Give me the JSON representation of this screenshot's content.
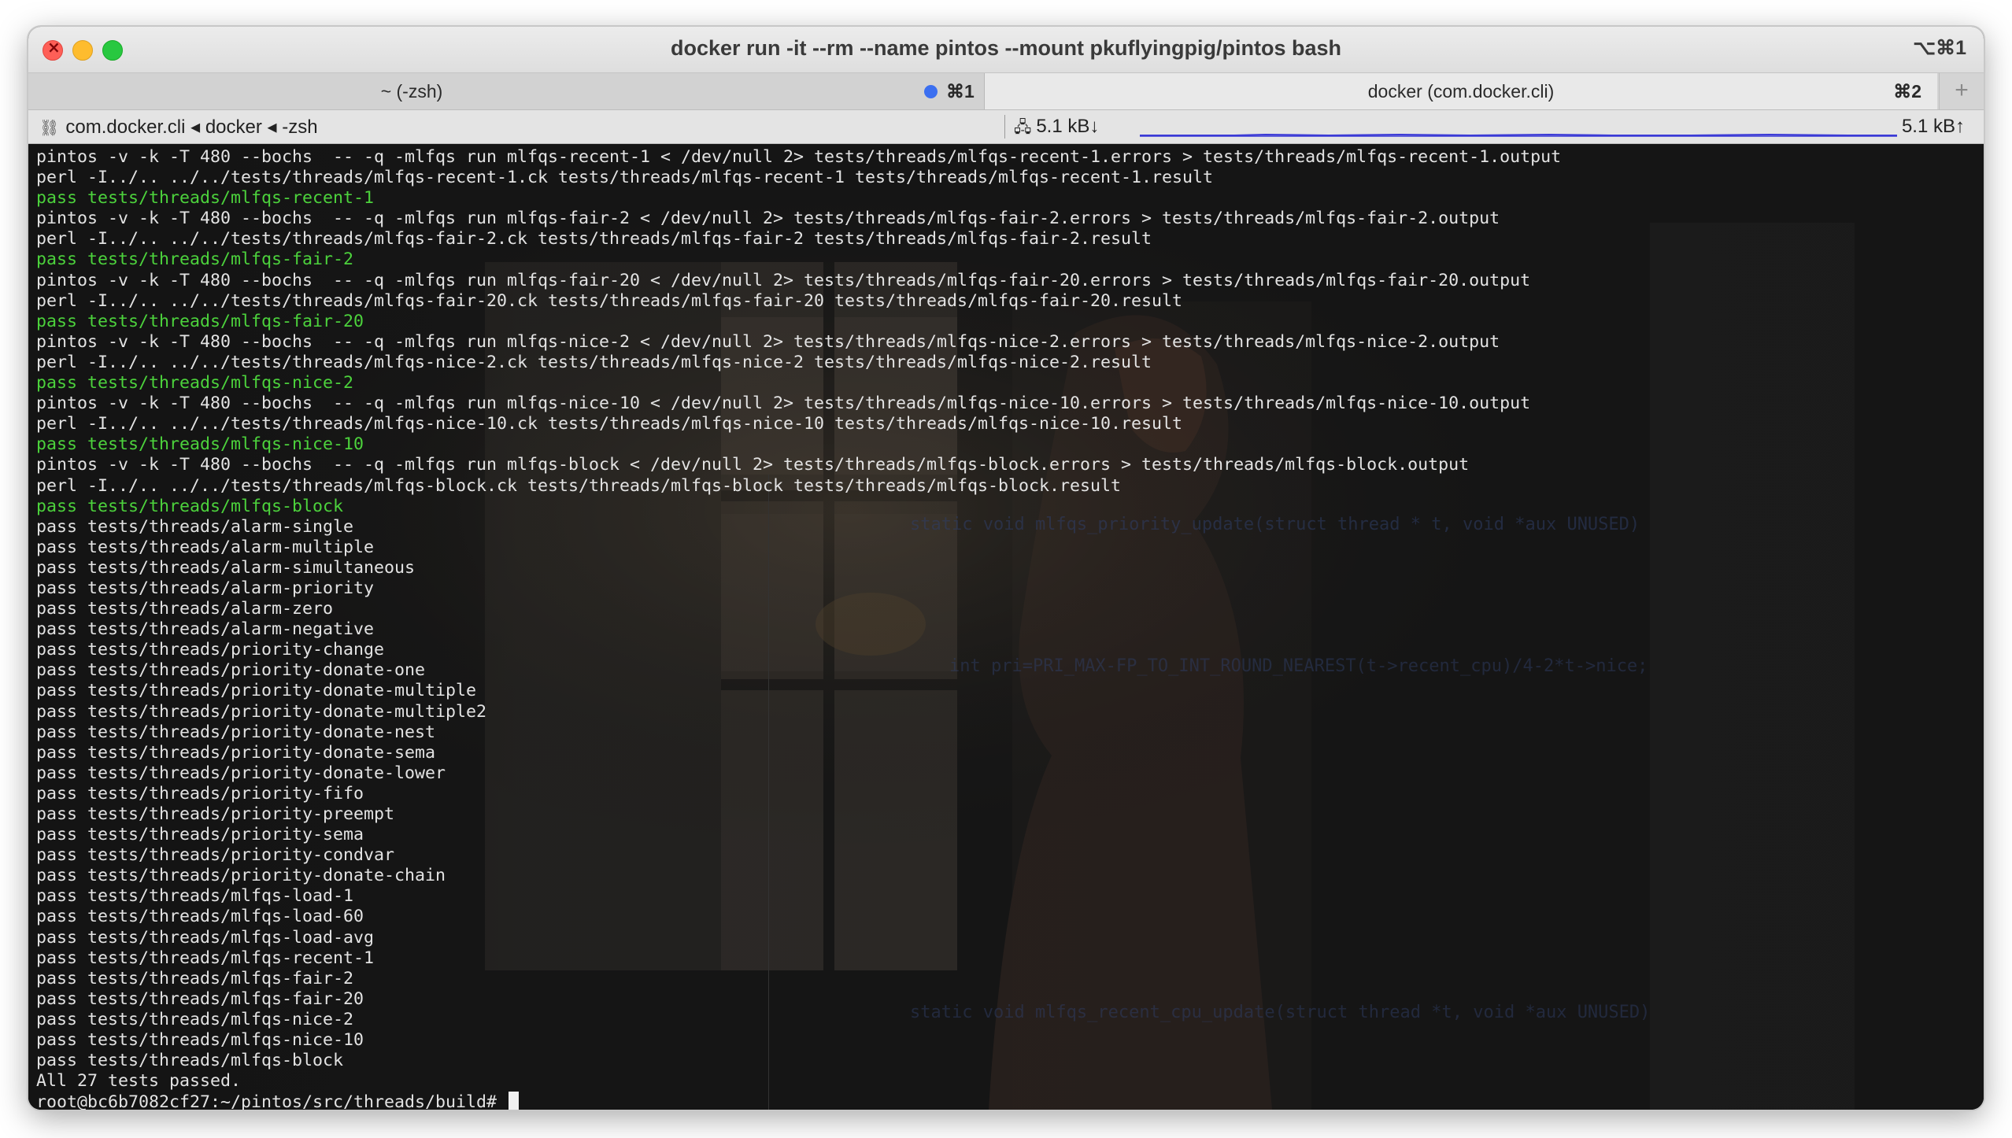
{
  "window": {
    "title": "docker run -it --rm --name pintos --mount  pkuflyingpig/pintos bash",
    "shortcut": "⌥⌘1"
  },
  "tabs": [
    {
      "label": "~ (-zsh)",
      "shortcut": "⌘1",
      "active": false
    },
    {
      "label": "docker (com.docker.cli)",
      "shortcut": "⌘2",
      "active": true
    }
  ],
  "status": {
    "breadcrumb": "com.docker.cli ◂ docker ◂ -zsh",
    "net_in": "5.1 kB↓",
    "net_out": "5.1 kB↑",
    "accent_color": "#3b3ad6"
  },
  "terminal": {
    "lines": [
      {
        "text": "pintos -v -k -T 480 --bochs  -- -q -mlfqs run mlfqs-recent-1 < /dev/null 2> tests/threads/mlfqs-recent-1.errors > tests/threads/mlfqs-recent-1.output",
        "color": "white"
      },
      {
        "text": "perl -I../.. ../../tests/threads/mlfqs-recent-1.ck tests/threads/mlfqs-recent-1 tests/threads/mlfqs-recent-1.result",
        "color": "white"
      },
      {
        "text": "pass tests/threads/mlfqs-recent-1",
        "color": "green"
      },
      {
        "text": "pintos -v -k -T 480 --bochs  -- -q -mlfqs run mlfqs-fair-2 < /dev/null 2> tests/threads/mlfqs-fair-2.errors > tests/threads/mlfqs-fair-2.output",
        "color": "white"
      },
      {
        "text": "perl -I../.. ../../tests/threads/mlfqs-fair-2.ck tests/threads/mlfqs-fair-2 tests/threads/mlfqs-fair-2.result",
        "color": "white"
      },
      {
        "text": "pass tests/threads/mlfqs-fair-2",
        "color": "green"
      },
      {
        "text": "pintos -v -k -T 480 --bochs  -- -q -mlfqs run mlfqs-fair-20 < /dev/null 2> tests/threads/mlfqs-fair-20.errors > tests/threads/mlfqs-fair-20.output",
        "color": "white"
      },
      {
        "text": "perl -I../.. ../../tests/threads/mlfqs-fair-20.ck tests/threads/mlfqs-fair-20 tests/threads/mlfqs-fair-20.result",
        "color": "white"
      },
      {
        "text": "pass tests/threads/mlfqs-fair-20",
        "color": "green"
      },
      {
        "text": "pintos -v -k -T 480 --bochs  -- -q -mlfqs run mlfqs-nice-2 < /dev/null 2> tests/threads/mlfqs-nice-2.errors > tests/threads/mlfqs-nice-2.output",
        "color": "white"
      },
      {
        "text": "perl -I../.. ../../tests/threads/mlfqs-nice-2.ck tests/threads/mlfqs-nice-2 tests/threads/mlfqs-nice-2.result",
        "color": "white"
      },
      {
        "text": "pass tests/threads/mlfqs-nice-2",
        "color": "green"
      },
      {
        "text": "pintos -v -k -T 480 --bochs  -- -q -mlfqs run mlfqs-nice-10 < /dev/null 2> tests/threads/mlfqs-nice-10.errors > tests/threads/mlfqs-nice-10.output",
        "color": "white"
      },
      {
        "text": "perl -I../.. ../../tests/threads/mlfqs-nice-10.ck tests/threads/mlfqs-nice-10 tests/threads/mlfqs-nice-10.result",
        "color": "white"
      },
      {
        "text": "pass tests/threads/mlfqs-nice-10",
        "color": "green"
      },
      {
        "text": "pintos -v -k -T 480 --bochs  -- -q -mlfqs run mlfqs-block < /dev/null 2> tests/threads/mlfqs-block.errors > tests/threads/mlfqs-block.output",
        "color": "white"
      },
      {
        "text": "perl -I../.. ../../tests/threads/mlfqs-block.ck tests/threads/mlfqs-block tests/threads/mlfqs-block.result",
        "color": "white"
      },
      {
        "text": "pass tests/threads/mlfqs-block",
        "color": "green"
      },
      {
        "text": "pass tests/threads/alarm-single",
        "color": "white"
      },
      {
        "text": "pass tests/threads/alarm-multiple",
        "color": "white"
      },
      {
        "text": "pass tests/threads/alarm-simultaneous",
        "color": "white"
      },
      {
        "text": "pass tests/threads/alarm-priority",
        "color": "white"
      },
      {
        "text": "pass tests/threads/alarm-zero",
        "color": "white"
      },
      {
        "text": "pass tests/threads/alarm-negative",
        "color": "white"
      },
      {
        "text": "pass tests/threads/priority-change",
        "color": "white"
      },
      {
        "text": "pass tests/threads/priority-donate-one",
        "color": "white"
      },
      {
        "text": "pass tests/threads/priority-donate-multiple",
        "color": "white"
      },
      {
        "text": "pass tests/threads/priority-donate-multiple2",
        "color": "white"
      },
      {
        "text": "pass tests/threads/priority-donate-nest",
        "color": "white"
      },
      {
        "text": "pass tests/threads/priority-donate-sema",
        "color": "white"
      },
      {
        "text": "pass tests/threads/priority-donate-lower",
        "color": "white"
      },
      {
        "text": "pass tests/threads/priority-fifo",
        "color": "white"
      },
      {
        "text": "pass tests/threads/priority-preempt",
        "color": "white"
      },
      {
        "text": "pass tests/threads/priority-sema",
        "color": "white"
      },
      {
        "text": "pass tests/threads/priority-condvar",
        "color": "white"
      },
      {
        "text": "pass tests/threads/priority-donate-chain",
        "color": "white"
      },
      {
        "text": "pass tests/threads/mlfqs-load-1",
        "color": "white"
      },
      {
        "text": "pass tests/threads/mlfqs-load-60",
        "color": "white"
      },
      {
        "text": "pass tests/threads/mlfqs-load-avg",
        "color": "white"
      },
      {
        "text": "pass tests/threads/mlfqs-recent-1",
        "color": "white"
      },
      {
        "text": "pass tests/threads/mlfqs-fair-2",
        "color": "white"
      },
      {
        "text": "pass tests/threads/mlfqs-fair-20",
        "color": "white"
      },
      {
        "text": "pass tests/threads/mlfqs-nice-2",
        "color": "white"
      },
      {
        "text": "pass tests/threads/mlfqs-nice-10",
        "color": "white"
      },
      {
        "text": "pass tests/threads/mlfqs-block",
        "color": "white"
      },
      {
        "text": "All 27 tests passed.",
        "color": "white"
      }
    ],
    "prompt": "root@bc6b7082cf27:~/pintos/src/threads/build# ",
    "colors": {
      "white": "#e3e3e3",
      "green": "#4cd23c",
      "background": "#141414"
    }
  }
}
